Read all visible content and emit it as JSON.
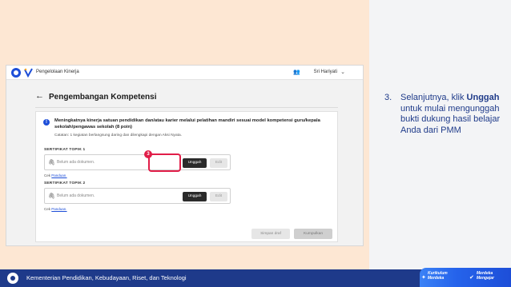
{
  "app": {
    "name": "Pengelolaan Kinerja",
    "user": "Sri Hariyati"
  },
  "page": {
    "title": "Pengembangan Kompetensi",
    "card_title": "Meningkatnya kinerja satuan pendidikan dan/atau karier melalui pelatihan mandiri sesuai model kompetensi guru/kepala sekolah/pengawas sekolah (8 poin)",
    "card_note": "Catatan: 1 kegiatan berlangsung daring dan dilengkapi dengan Aksi Nyata.",
    "sections": [
      {
        "label": "SERTIFIKAT TOPIK 1",
        "doc_placeholder": "Belum ada dokumen.",
        "upload_label": "Unggah",
        "edit_label": "Edit",
        "guide_prefix": "Cek",
        "guide_link": "Panduan."
      },
      {
        "label": "SERTIFIKAT TOPIK 2",
        "doc_placeholder": "Belum ada dokumen.",
        "upload_label": "Unggah",
        "edit_label": "Edit",
        "guide_prefix": "Cek",
        "guide_link": "Panduan."
      }
    ],
    "save_label": "Simpan draf",
    "submit_label": "Kumpulkan",
    "step_number": "3"
  },
  "instruction": {
    "number": "3.",
    "text_before": "Selanjutnya, klik ",
    "bold": "Unggah",
    "text_after": " untuk mulai mengunggah bukti dukung hasil belajar Anda dari PMM"
  },
  "footer": {
    "ministry": "Kementerian Pendidikan, Kebudayaan, Riset, dan Teknologi",
    "brand_left_1": "Kurikulum",
    "brand_left_2": "Merdeka",
    "brand_right_1": "Merdeka",
    "brand_right_2": "Mengajar"
  },
  "colors": {
    "accent": "#1e3a8a",
    "highlight": "#e11d48",
    "background": "#fde7d3"
  }
}
